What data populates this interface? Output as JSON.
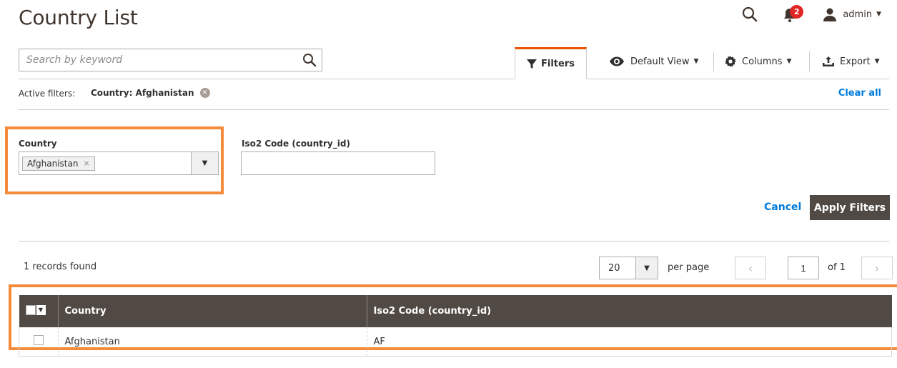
{
  "header": {
    "title": "Country List",
    "notifications_count": "2",
    "user_name": "admin"
  },
  "toolbar": {
    "search_placeholder": "Search by keyword",
    "filters_label": "Filters",
    "view_label": "Default View",
    "columns_label": "Columns",
    "export_label": "Export"
  },
  "active_filters": {
    "label": "Active filters:",
    "chip": "Country: Afghanistan",
    "clear_all": "Clear all"
  },
  "filters": {
    "country_label": "Country",
    "country_selected": "Afghanistan",
    "country_chip_remove": "×",
    "iso_label": "Iso2 Code (country_id)",
    "iso_value": "",
    "cancel_label": "Cancel",
    "apply_label": "Apply Filters"
  },
  "pager": {
    "records": "1 records found",
    "per_page_value": "20",
    "per_page_label": "per page",
    "current_page": "1",
    "of_pages": "of 1",
    "prev": "‹",
    "next": "›"
  },
  "grid": {
    "columns": [
      "Country",
      "Iso2 Code (country_id)"
    ],
    "rows": [
      {
        "country": "Afghanistan",
        "iso2": "AF"
      }
    ]
  },
  "colors": {
    "accent": "#eb5202",
    "highlight": "#f48a3a",
    "link": "#007bdb",
    "header_bg": "#514943",
    "badge": "#e22626"
  }
}
